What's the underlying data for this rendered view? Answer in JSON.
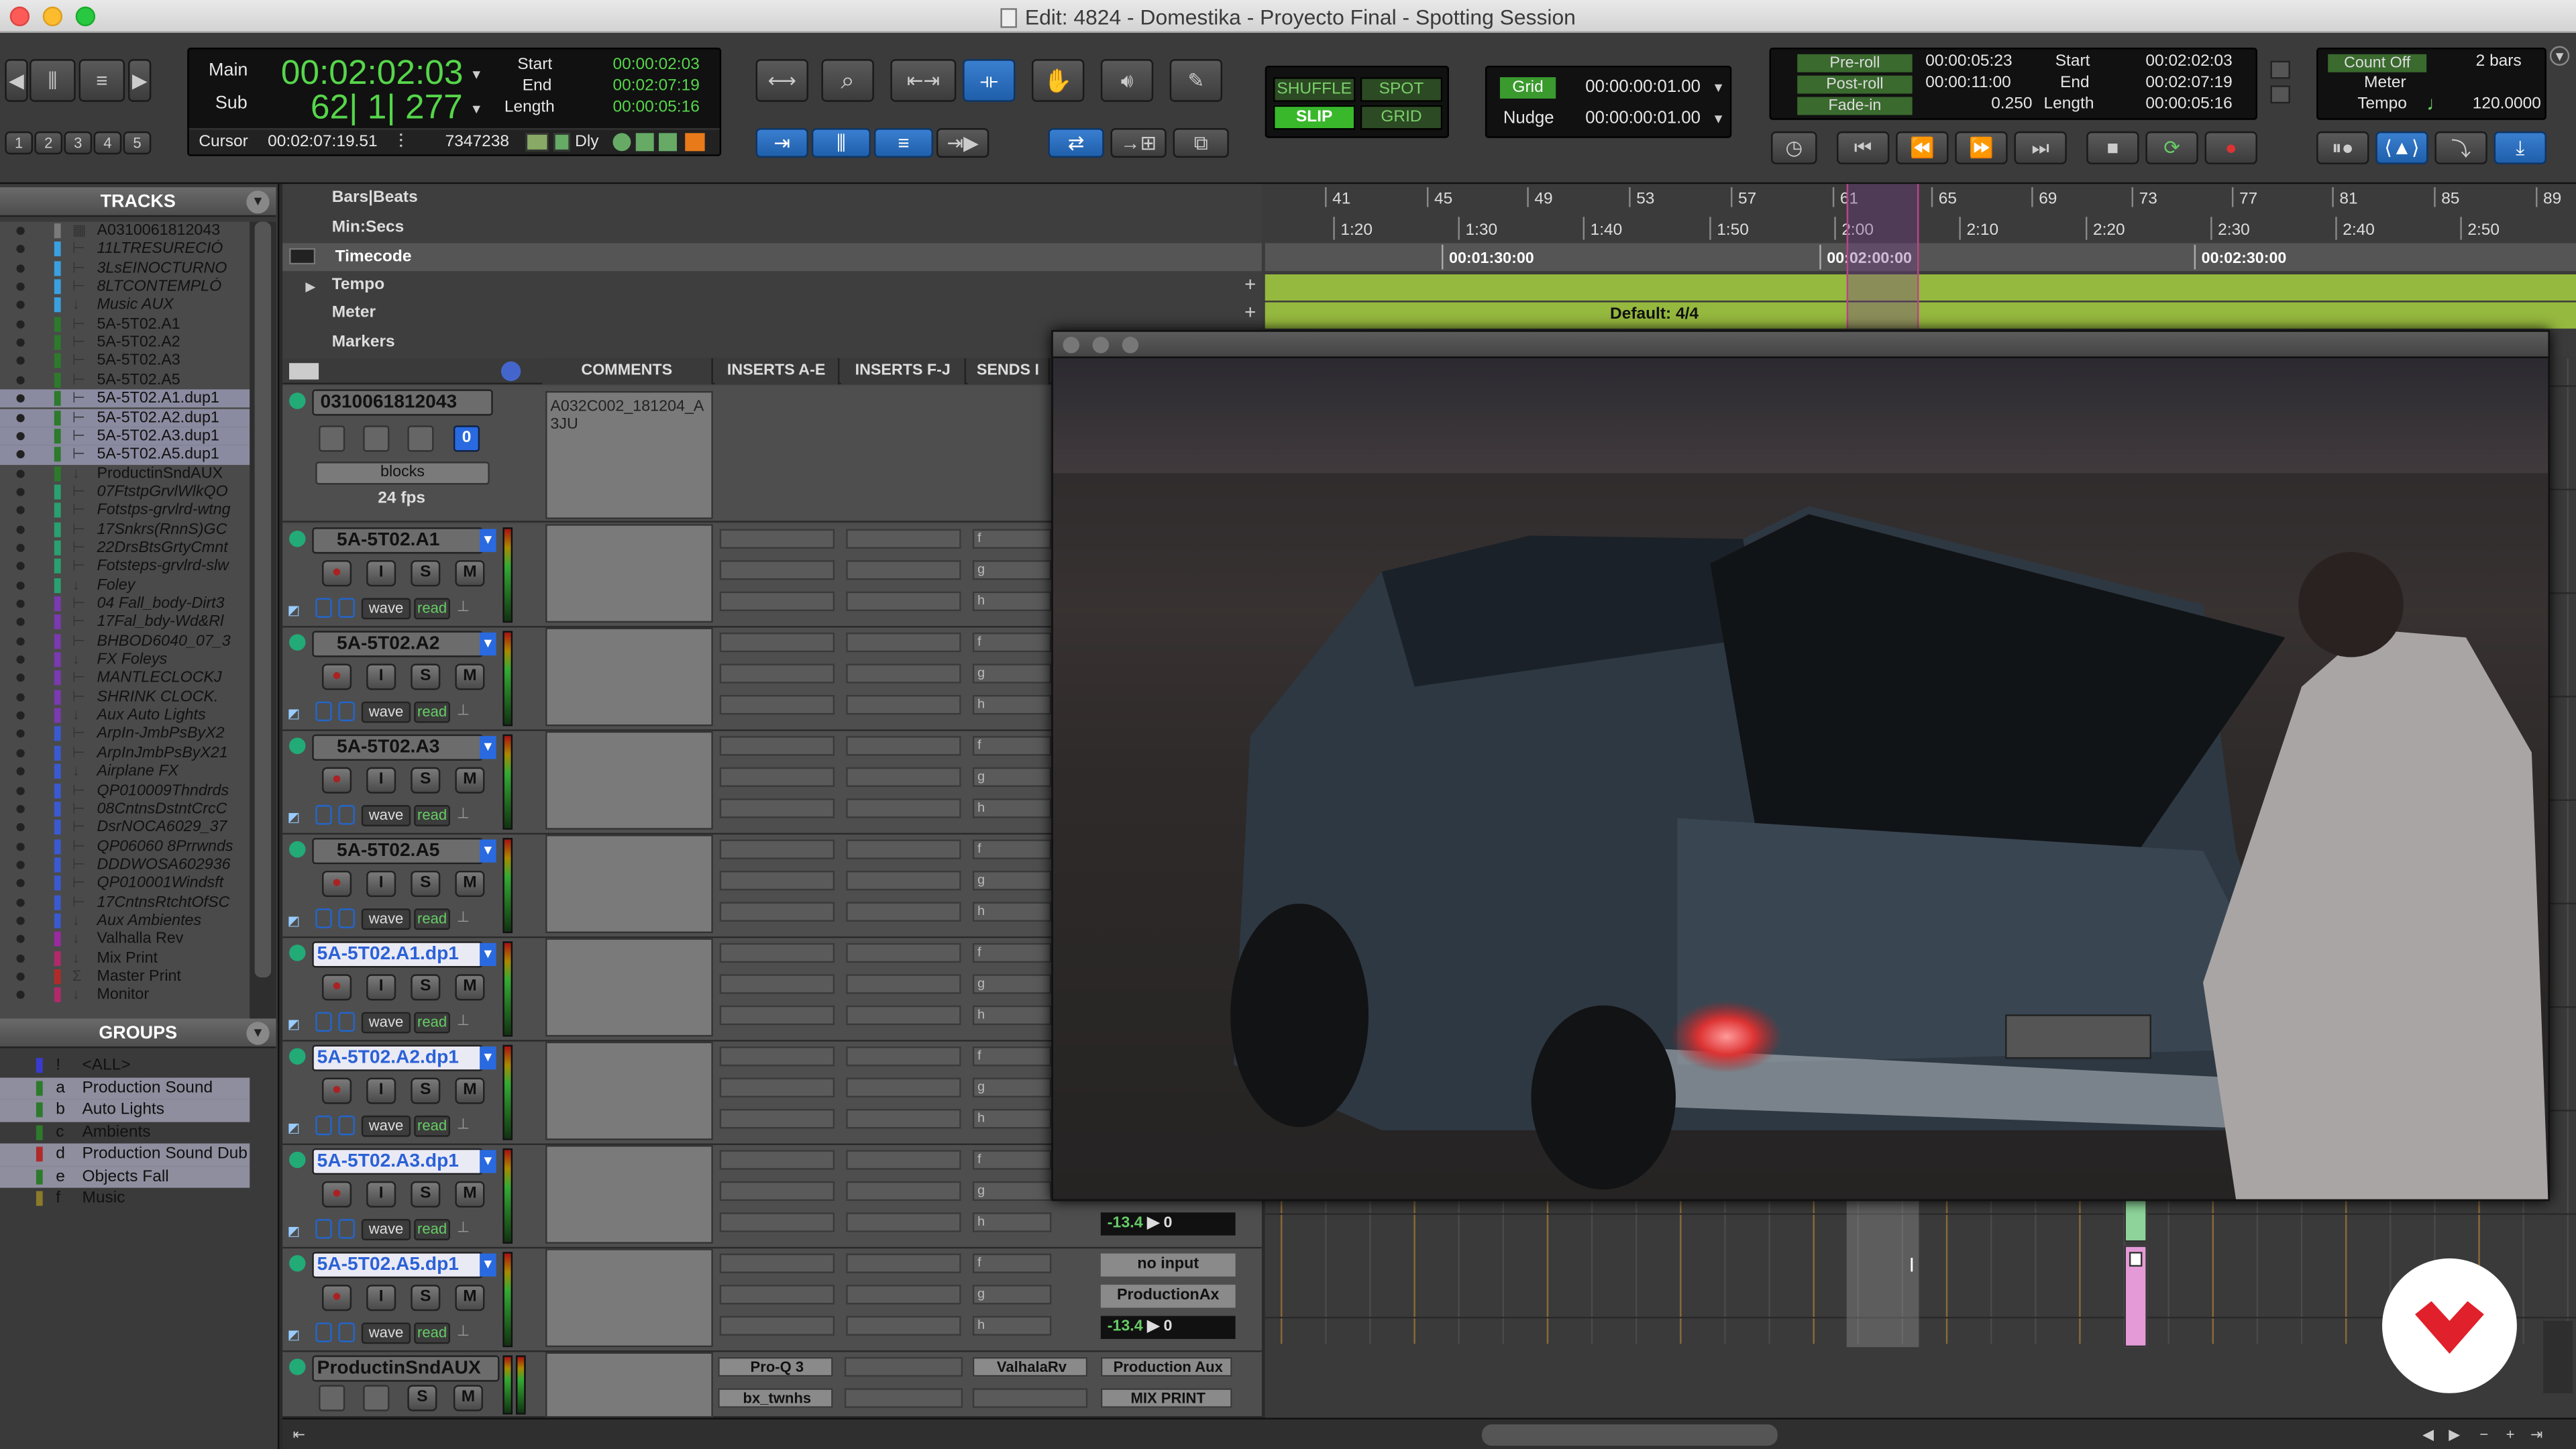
{
  "window": {
    "title": "Edit: 4824 - Domestika - Proyecto Final - Spotting Session"
  },
  "counter": {
    "main_label": "Main",
    "sub_label": "Sub",
    "main_value": "00:02:02:03",
    "sub_value": "62| 1| 277",
    "start_label": "Start",
    "end_label": "End",
    "length_label": "Length",
    "start": "00:00:02:03",
    "end": "00:02:07:19",
    "length": "00:00:05:16",
    "cursor_label": "Cursor",
    "cursor_value": "00:02:07:19.51",
    "samples": "7347238",
    "dly_label": "Dly"
  },
  "edit_modes": {
    "shuffle": "SHUFFLE",
    "spot": "SPOT",
    "slip": "SLIP",
    "grid": "GRID"
  },
  "grid": {
    "grid_label": "Grid",
    "grid_value": "00:00:00:01.00",
    "nudge_label": "Nudge",
    "nudge_value": "00:00:00:01.00"
  },
  "transport": {
    "preroll_label": "Pre-roll",
    "preroll": "00:00:05:23",
    "postroll_label": "Post-roll",
    "postroll": "00:00:11:00",
    "fadein_label": "Fade-in",
    "fadein": "0.250",
    "start_label": "Start",
    "start": "00:02:02:03",
    "end_label": "End",
    "end": "00:02:07:19",
    "length_label": "Length",
    "length": "00:00:05:16"
  },
  "midi": {
    "countoff_label": "Count Off",
    "countoff_value": "2 bars",
    "meter_label": "Meter",
    "tempo_label": "Tempo",
    "tempo_value": "120.0000"
  },
  "tracks_panel": {
    "title": "TRACKS",
    "items": [
      {
        "name": "A0310061812043",
        "color": "#7a7a7a",
        "type": "video",
        "italic": false
      },
      {
        "name": "11LTRESURECIÓ",
        "color": "#3aa0e0",
        "type": "audio",
        "italic": true
      },
      {
        "name": "3LsEINOCTURNO",
        "color": "#3aa0e0",
        "type": "audio",
        "italic": true
      },
      {
        "name": "8LTCONTEMPLÓ",
        "color": "#3aa0e0",
        "type": "audio",
        "italic": true
      },
      {
        "name": "Music AUX",
        "color": "#3aa0e0",
        "type": "aux",
        "italic": true
      },
      {
        "name": "5A-5T02.A1",
        "color": "#2d7a2d",
        "type": "audio",
        "italic": false
      },
      {
        "name": "5A-5T02.A2",
        "color": "#2d7a2d",
        "type": "audio",
        "italic": false
      },
      {
        "name": "5A-5T02.A3",
        "color": "#2d7a2d",
        "type": "audio",
        "italic": false
      },
      {
        "name": "5A-5T02.A5",
        "color": "#2d7a2d",
        "type": "audio",
        "italic": false
      },
      {
        "name": "5A-5T02.A1.dup1",
        "color": "#2d7a2d",
        "type": "audio",
        "italic": false
      },
      {
        "name": "5A-5T02.A2.dup1",
        "color": "#2d7a2d",
        "type": "audio",
        "italic": false
      },
      {
        "name": "5A-5T02.A3.dup1",
        "color": "#2d7a2d",
        "type": "audio",
        "italic": false
      },
      {
        "name": "5A-5T02.A5.dup1",
        "color": "#2d7a2d",
        "type": "audio",
        "italic": false
      },
      {
        "name": "ProductinSndAUX",
        "color": "#2d7a2d",
        "type": "aux",
        "italic": false
      },
      {
        "name": "07FtstpGrvlWlkQO",
        "color": "#2aa070",
        "type": "audio",
        "italic": true
      },
      {
        "name": "Fotstps-grvlrd-wtng",
        "color": "#2aa070",
        "type": "audio",
        "italic": true
      },
      {
        "name": "17Snkrs(RnnS)GC",
        "color": "#2aa070",
        "type": "audio",
        "italic": true
      },
      {
        "name": "22DrsBtsGrtyCmnt",
        "color": "#2aa070",
        "type": "audio",
        "italic": true
      },
      {
        "name": "Fotsteps-grvlrd-slw",
        "color": "#2aa070",
        "type": "audio",
        "italic": true
      },
      {
        "name": "Foley",
        "color": "#2aa070",
        "type": "aux",
        "italic": true
      },
      {
        "name": "04 Fall_body-Dirt3",
        "color": "#7a3ab0",
        "type": "audio",
        "italic": true
      },
      {
        "name": "17Fal_bdy-Wd&Rl",
        "color": "#7a3ab0",
        "type": "audio",
        "italic": true
      },
      {
        "name": "BHBOD6040_07_3",
        "color": "#7a3ab0",
        "type": "audio",
        "italic": true
      },
      {
        "name": "FX Foleys",
        "color": "#7a3ab0",
        "type": "aux",
        "italic": true
      },
      {
        "name": "MANTLECLOCKJ",
        "color": "#7a3ab0",
        "type": "audio",
        "italic": true
      },
      {
        "name": "SHRINK CLOCK.",
        "color": "#7a3ab0",
        "type": "audio",
        "italic": true
      },
      {
        "name": "Aux Auto Lights",
        "color": "#7a3ab0",
        "type": "aux",
        "italic": true
      },
      {
        "name": "ArpIn-JmbPsByX2",
        "color": "#3a5ad0",
        "type": "audio",
        "italic": true
      },
      {
        "name": "ArpInJmbPsByX21",
        "color": "#3a5ad0",
        "type": "audio",
        "italic": true
      },
      {
        "name": "Airplane FX",
        "color": "#3a5ad0",
        "type": "aux",
        "italic": true
      },
      {
        "name": "QP010009Thndrds",
        "color": "#3a5ad0",
        "type": "audio",
        "italic": true
      },
      {
        "name": "08CntnsDstntCrcC",
        "color": "#3a5ad0",
        "type": "audio",
        "italic": true
      },
      {
        "name": "DsrNOCA6029_37",
        "color": "#3a5ad0",
        "type": "audio",
        "italic": true
      },
      {
        "name": "QP06060 8Prrwnds",
        "color": "#3a5ad0",
        "type": "audio",
        "italic": true
      },
      {
        "name": "DDDWOSA602936",
        "color": "#3a5ad0",
        "type": "audio",
        "italic": true
      },
      {
        "name": "QP010001Windsft",
        "color": "#3a5ad0",
        "type": "audio",
        "italic": true
      },
      {
        "name": "17CntnsRtchtOfSC",
        "color": "#3a5ad0",
        "type": "audio",
        "italic": true
      },
      {
        "name": "Aux Ambientes",
        "color": "#3a5ad0",
        "type": "aux",
        "italic": true
      },
      {
        "name": "Valhalla Rev",
        "color": "#9a2aa0",
        "type": "aux",
        "italic": false
      },
      {
        "name": "Mix Print",
        "color": "#b02a6a",
        "type": "aux",
        "italic": false
      },
      {
        "name": "Master Print",
        "color": "#b02a2a",
        "type": "master",
        "italic": false
      },
      {
        "name": "Monitor",
        "color": "#b02a6a",
        "type": "aux",
        "italic": false
      }
    ]
  },
  "groups_panel": {
    "title": "GROUPS",
    "items": [
      {
        "id": "!",
        "name": "<ALL>",
        "color": "#3a3ad0"
      },
      {
        "id": "a",
        "name": "Production Sound",
        "color": "#2d7a2d"
      },
      {
        "id": "b",
        "name": "Auto Lights",
        "color": "#2d7a2d"
      },
      {
        "id": "c",
        "name": "Ambients",
        "color": "#2d7a2d"
      },
      {
        "id": "d",
        "name": "Production Sound Dub",
        "color": "#b02a2a"
      },
      {
        "id": "e",
        "name": "Objects Fall",
        "color": "#2d7a2d"
      },
      {
        "id": "f",
        "name": "Music",
        "color": "#8a7a2a"
      }
    ]
  },
  "rulers": {
    "bars_label": "Bars|Beats",
    "minsecs_label": "Min:Secs",
    "timecode_label": "Timecode",
    "tempo_label": "Tempo",
    "meter_label": "Meter",
    "markers_label": "Markers",
    "bars": [
      "41",
      "45",
      "49",
      "53",
      "57",
      "61",
      "65",
      "69",
      "73",
      "77",
      "81",
      "85",
      "89"
    ],
    "minsecs": [
      "1:20",
      "1:30",
      "1:40",
      "1:50",
      "2:00",
      "2:10",
      "2:20",
      "2:30",
      "2:40",
      "2:50"
    ],
    "timecodes": [
      "00:01:30:00",
      "00:02:00:00",
      "00:02:30:00"
    ],
    "meter_value": "Default: 4/4"
  },
  "columns": {
    "comments": "COMMENTS",
    "inserts_ae": "INSERTS A-E",
    "inserts_fj": "INSERTS F-J",
    "sends": "SENDS I"
  },
  "video_track": {
    "name": "0310061812043",
    "comment": "A032C002_181204_A3JU",
    "mode": "blocks",
    "fps": "24 fps"
  },
  "audio_tracks": [
    {
      "name": "5A-5T02.A1",
      "selected": false,
      "playlist": "wave",
      "auto": "read"
    },
    {
      "name": "5A-5T02.A2",
      "selected": false,
      "playlist": "wave",
      "auto": "read"
    },
    {
      "name": "5A-5T02.A3",
      "selected": false,
      "playlist": "wave",
      "auto": "read"
    },
    {
      "name": "5A-5T02.A5",
      "selected": false,
      "playlist": "wave",
      "auto": "read"
    },
    {
      "name": "5A-5T02.A1.dp1",
      "selected": true,
      "playlist": "wave",
      "auto": "read"
    },
    {
      "name": "5A-5T02.A2.dp1",
      "selected": true,
      "playlist": "wave",
      "auto": "read"
    },
    {
      "name": "5A-5T02.A3.dp1",
      "selected": true,
      "playlist": "wave",
      "auto": "read"
    },
    {
      "name": "5A-5T02.A5.dp1",
      "selected": true,
      "playlist": "wave",
      "auto": "read"
    }
  ],
  "aux_track": {
    "name": "ProductinSndAUX",
    "insert1": "Pro-Q 3",
    "insert2": "bx_twnhs",
    "send1": "ValhalaRv",
    "output1": "Production Aux",
    "output2": "MIX PRINT"
  },
  "io": {
    "level_a": "-13.4",
    "pan_a": "0",
    "level_b": "-13.4",
    "pan_b": "0",
    "input": "no input",
    "output": "ProductionAx"
  },
  "send_letters": [
    "f",
    "g",
    "h"
  ],
  "track_buttons": {
    "rec": "●",
    "input": "I",
    "solo": "S",
    "mute": "M",
    "voice": "0"
  },
  "icons": {
    "record": "record-icon",
    "play": "play-icon",
    "stop": "stop-icon",
    "loop": "loop-icon"
  }
}
